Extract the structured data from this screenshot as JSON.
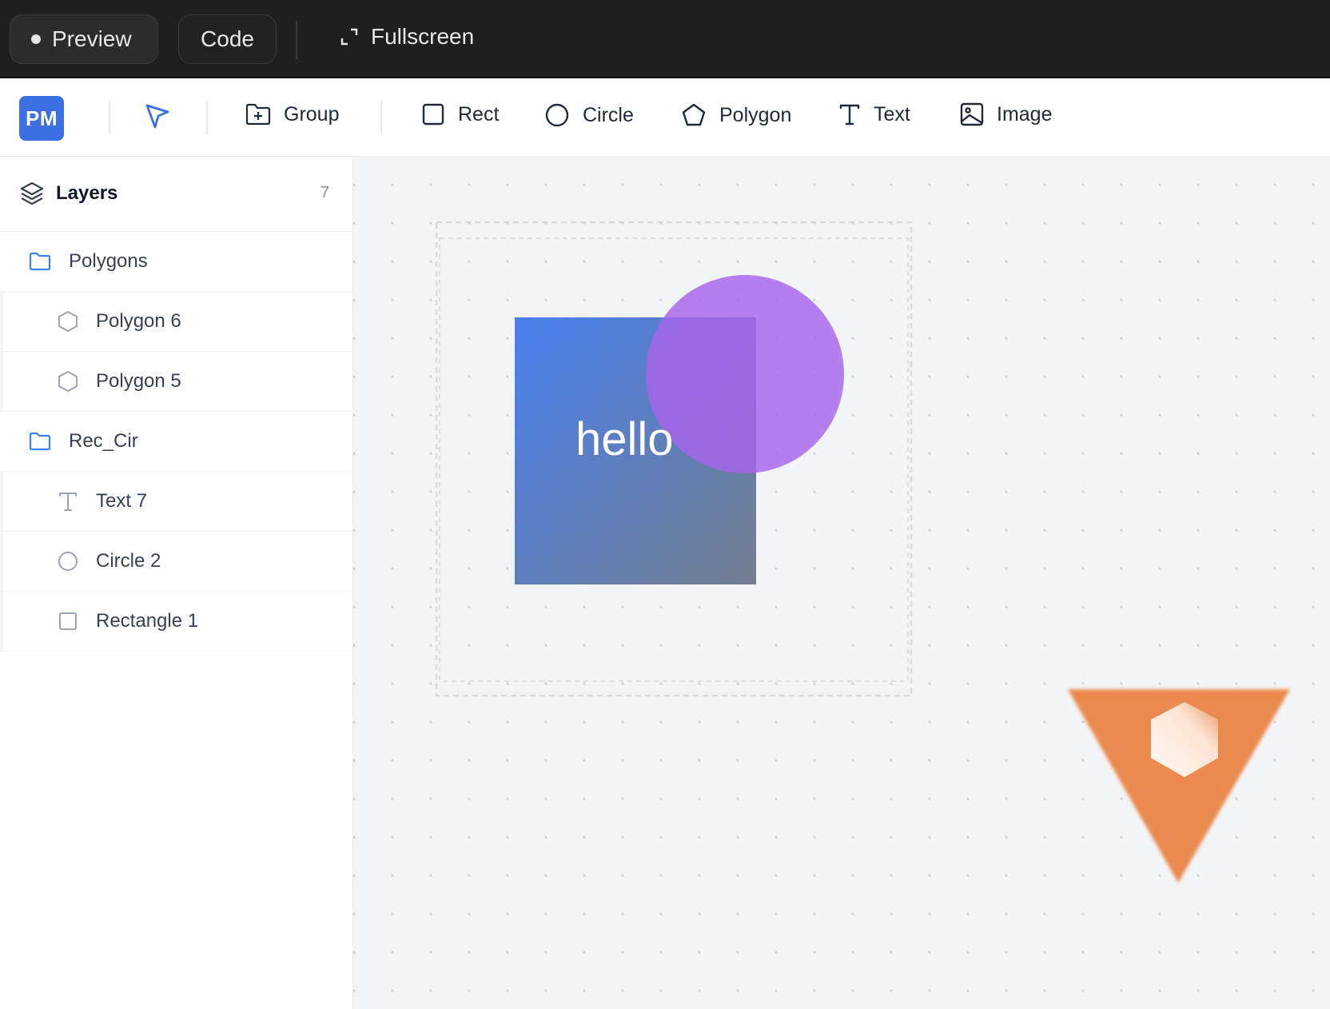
{
  "topbar": {
    "preview_label": "Preview",
    "code_label": "Code",
    "fullscreen_label": "Fullscreen"
  },
  "toolbar": {
    "logo_text": "PM",
    "tools": {
      "group": "Group",
      "rect": "Rect",
      "circle": "Circle",
      "polygon": "Polygon",
      "text": "Text",
      "image": "Image"
    }
  },
  "layers": {
    "title": "Layers",
    "count": "7",
    "items": [
      {
        "label": "Polygons",
        "kind": "group",
        "icon": "folder-icon"
      },
      {
        "label": "Polygon 6",
        "kind": "child",
        "icon": "hexagon-icon"
      },
      {
        "label": "Polygon 5",
        "kind": "child",
        "icon": "hexagon-icon"
      },
      {
        "label": "Rec_Cir",
        "kind": "group",
        "icon": "folder-icon"
      },
      {
        "label": "Text 7",
        "kind": "child",
        "icon": "text-icon"
      },
      {
        "label": "Circle 2",
        "kind": "child",
        "icon": "circle-icon"
      },
      {
        "label": "Rectangle 1",
        "kind": "child",
        "icon": "square-icon"
      }
    ]
  },
  "canvas": {
    "text_shape": "hello",
    "colors": {
      "rect_gradient_start": "#4a80ef",
      "rect_gradient_end": "#727c8c",
      "circle_fill": "#a764ec",
      "triangle_fill": "#ea8a4f",
      "hexagon_fill": "#fbe0d0",
      "accent": "#3b6fe0"
    }
  }
}
